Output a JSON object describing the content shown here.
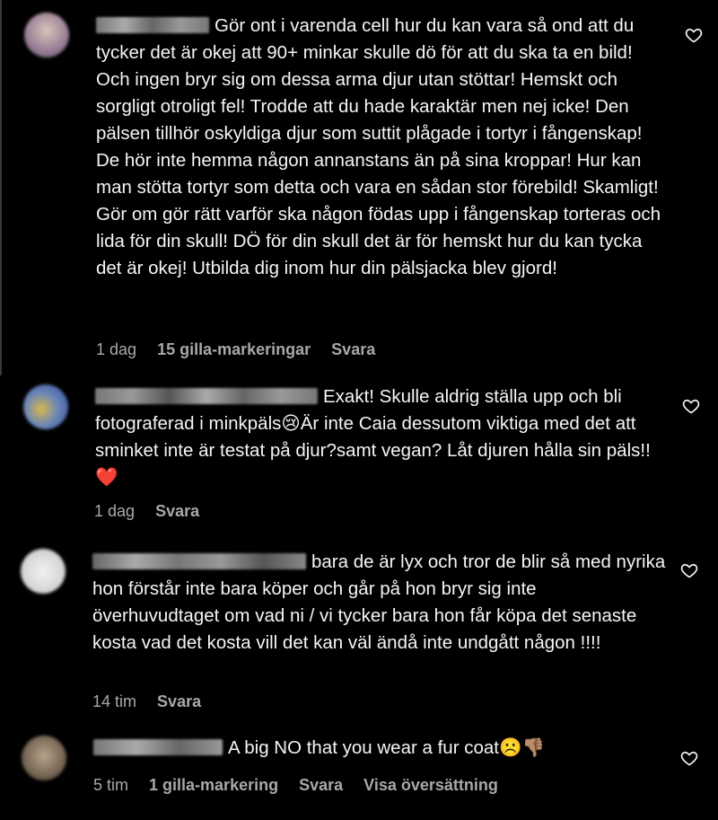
{
  "comments": [
    {
      "text": "Gör ont i varenda cell hur du kan vara så ond att du tycker det är okej att 90+ minkar skulle dö för att du ska ta en bild! Och ingen bryr sig om dessa arma djur utan stöttar! Hemskt och sorgligt otroligt fel! Trodde att du hade karaktär men nej icke! Den pälsen tillhör oskyldiga djur som suttit plågade i tortyr i fångenskap! De hör inte hemma någon annanstans än på sina kroppar! Hur kan man stötta tortyr som detta och vara en sådan stor förebild! Skamligt! Gör om gör rätt varför ska någon födas upp i fångenskap torteras och lida för din skull! DÖ för din skull det är för hemskt hur du kan tycka det är okej! Utbilda dig inom hur din pälsjacka blev gjord!",
      "time": "1 dag",
      "likes": "15 gilla-markeringar",
      "reply": "Svara"
    },
    {
      "text": "Exakt! Skulle aldrig ställa upp och bli fotograferad i minkpäls😢Är inte Caia dessutom viktiga med det att sminket inte är testat på djur?samt vegan? Låt djuren hålla sin päls!!❤️",
      "time": "1 dag",
      "reply": "Svara"
    },
    {
      "text": "bara de är lyx och tror de blir så med nyrika hon förstår inte bara köper och går på hon bryr sig inte överhuvudtaget om vad ni / vi tycker bara hon får köpa det senaste kosta vad det kosta vill det kan väl ändå inte undgått någon !!!!",
      "time": "14 tim",
      "reply": "Svara"
    },
    {
      "text": "A big NO that you wear a fur coat☹️👎🏽",
      "time": "5 tim",
      "likes": "1 gilla-markering",
      "reply": "Svara",
      "translate": "Visa översättning"
    }
  ],
  "icons": {
    "like": "heart-outline-icon"
  },
  "colors": {
    "background": "#000000",
    "text": "#f5f5f5",
    "meta": "#a8a8a8"
  }
}
